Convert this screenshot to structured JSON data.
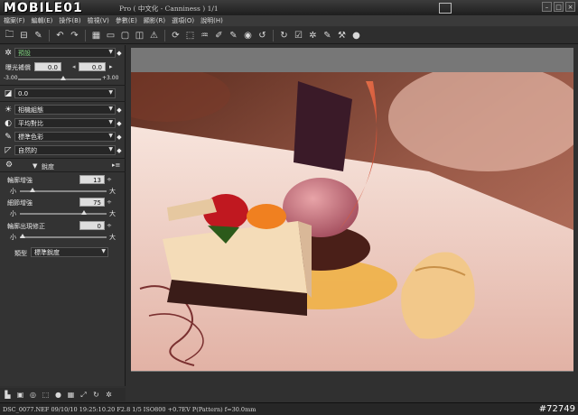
{
  "app": {
    "logo_text": "MOBILE01",
    "title": "Pro ( 中文化 - Canniness )    1/1"
  },
  "menu": [
    "檔案(F)",
    "編輯(E)",
    "操作(B)",
    "檢視(V)",
    "參數(E)",
    "顯影(R)",
    "選項(O)",
    "說明(H)"
  ],
  "toolbar": {
    "icons": [
      "folder-icon",
      "open-icon",
      "eyedropper-icon",
      "undo-icon",
      "redo-icon",
      "grid-icon",
      "strip-icon",
      "single-view-icon",
      "compare-icon",
      "warning-icon",
      "rotate-icon",
      "crop-icon",
      "curve-icon",
      "brush-icon",
      "pen-icon",
      "redeye-icon",
      "rotate-left-icon",
      "rotate-right-icon",
      "check-icon",
      "settings-icon",
      "paint-icon",
      "hammer-icon",
      "badge-icon"
    ],
    "symbols": [
      "🗀",
      "⊟",
      "✎",
      "↶",
      "↷",
      "▦",
      "▭",
      "▢",
      "◫",
      "⚠",
      "⟳",
      "⬚",
      "♒",
      "✐",
      "✎",
      "◉",
      "↺",
      "↻",
      "☑",
      "✲",
      "✎",
      "⚒",
      "●"
    ]
  },
  "panel": {
    "preset_value": "預設",
    "exposure_label": "曝光補償",
    "exposure_value": "0.0",
    "exposure_right_value": "0.0",
    "exposure_min": "-3.00",
    "exposure_max": "+3.00",
    "wb_value": "0.0",
    "contrast_value": "相機組態",
    "tone_value": "平均對比",
    "color_value": "標準色彩",
    "style_value": "自然的",
    "sharpen_tab": "銳度",
    "sharpen_strength_label": "輪廓增強",
    "sharpen_strength_value": "13",
    "detail_label": "細節增強",
    "detail_value": "75",
    "edge_label": "輪廓出現修正",
    "edge_value": "0",
    "small": "小",
    "large": "大",
    "type_label": "類型",
    "type_value": "標準銳度"
  },
  "bottom_tools": [
    "histogram-icon",
    "image-icon",
    "target-icon",
    "crop-small-icon",
    "sphere-icon",
    "grid-small-icon",
    "expand-icon",
    "refresh-icon",
    "gear-small-icon"
  ],
  "status": {
    "text": "DSC_0077.NEF 09/10/10 19:25:10.20 F2.8 1/5 ISO800 +0.7EV P(Pattern) f=30.0mm",
    "watermark": "#72749"
  },
  "colors": {
    "preset_green": "#7fd07f",
    "panel_bg": "#333333",
    "plate_color": "#f1d8d0"
  }
}
